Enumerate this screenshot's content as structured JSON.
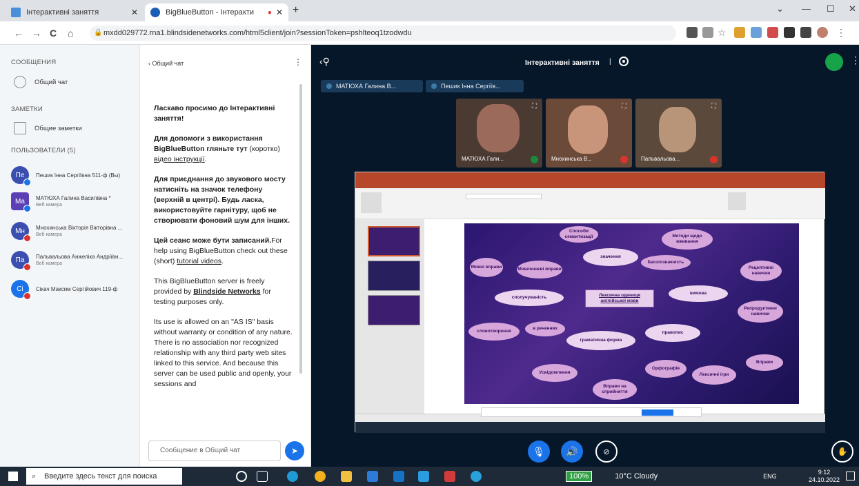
{
  "browser": {
    "tabs": [
      {
        "title": "Інтерактивні заняття",
        "favicon_color": "#4a90d9"
      },
      {
        "title": "BigBlueButton - Інтеракти",
        "favicon_color": "#1a5fb4"
      }
    ],
    "url": "mxdd029772.rna1.blindsidenetworks.com/html5client/join?sessionToken=pshlteoq1tzodwdu"
  },
  "sidebar": {
    "messages_header": "СООБЩЕНИЯ",
    "public_chat": "Общий чат",
    "notes_header": "ЗАМЕТКИ",
    "shared_notes": "Общие заметки",
    "users_header": "ПОЛЬЗОВАТЕЛИ (5)",
    "users": [
      {
        "initials": "Пе",
        "name": "Пешик Інна Сергіївна 511-ф (Вы)",
        "sub": "",
        "color": "#3a4fb0",
        "status_color": "#1a73e8"
      },
      {
        "initials": "Ма",
        "name": "МАТЮХА Галина Василівна *",
        "sub": "Веб камера",
        "color": "#5b3fb5",
        "status_color": "#1a73e8"
      },
      {
        "initials": "Мн",
        "name": "Мнохинська Вікторія Вікторівна ...",
        "sub": "Веб камера",
        "color": "#3a4fb0",
        "status_color": "#d9332e"
      },
      {
        "initials": "Па",
        "name": "Пальвальова Анжеліка Андріївн...",
        "sub": "Веб камера",
        "color": "#3a4fb0",
        "status_color": "#d9332e"
      },
      {
        "initials": "Сі",
        "name": "Сікач Максим Сергійович 119-ф",
        "sub": "",
        "color": "#1a73e8",
        "status_color": "#d9332e"
      }
    ]
  },
  "chat": {
    "back_label": "Общий чат",
    "input_placeholder": "Сообщение в Общий чат",
    "welcome_1a": "Ласкаво просимо до ",
    "welcome_1b": "Інтерактивні заняття",
    "welcome_1c": "!",
    "help_a": "Для допомоги з використання BigBlueButton ",
    "help_b": "гляньте тут",
    "help_c": " (коротко) ",
    "help_d": "відео інструкції",
    "help_e": ".",
    "audio_a": "Для приєднання до звукового мосту натисніть на значок телефону (верхній в центрі). ",
    "audio_b": "Будь ласка, використовуйте гарнітуру, щоб не створювати фоновий шум для інших.",
    "rec_a": "Цей сеанс може бути записаний.",
    "rec_b": "For help using BigBlueButton check out these (short) ",
    "rec_c": "tutorial videos",
    "rec_d": ".",
    "srv_a": "This BigBlueButton server is freely provided by ",
    "srv_b": "Blindside Networks",
    "srv_c": " for testing purposes only.",
    "asis": "Its use is allowed on an \"AS IS\" basis without warranty or condition of any nature. There is no association nor recognized relationship with any third party web sites linked to this service. And because this server can be used public and openly, your sessions and"
  },
  "meeting": {
    "title": "Інтерактивні заняття",
    "talkers": [
      "МАТЮХА Галина В...",
      "Пешик Інна Сергіїв..."
    ],
    "tiles": [
      {
        "name": "МАТЮХА Гали...",
        "bg": "#4a3a32",
        "mic_color": "#1a8b3c"
      },
      {
        "name": "Мнохинська В...",
        "bg": "#6b4a3a",
        "mic_color": "#d9332e"
      },
      {
        "name": "Пальвальова...",
        "bg": "#5b4a3c",
        "mic_color": "#d9332e"
      }
    ]
  },
  "slide": {
    "center": "Лексична одиниця англійської мови",
    "clouds": [
      "Способи семантизації",
      "значення",
      "Методи щодо вживання",
      "Багатозначність",
      "Рецептивні навички",
      "Мовні вправи",
      "Мовленнєві вправи",
      "сполучуваність",
      "вимова",
      "Репродуктивні навички",
      "словотворення",
      "в реченнях",
      "граматична форма",
      "правопис",
      "Вправи",
      "Усвідомлення",
      "Вправи на сприйняття",
      "Орфографія",
      "Лексичні ігри"
    ]
  },
  "taskbar": {
    "search_placeholder": "Введите здесь текст для поиска",
    "battery": "100%",
    "weather": "10°C  Cloudy",
    "lang": "ENG",
    "time": "9:12",
    "date": "24.10.2022"
  }
}
